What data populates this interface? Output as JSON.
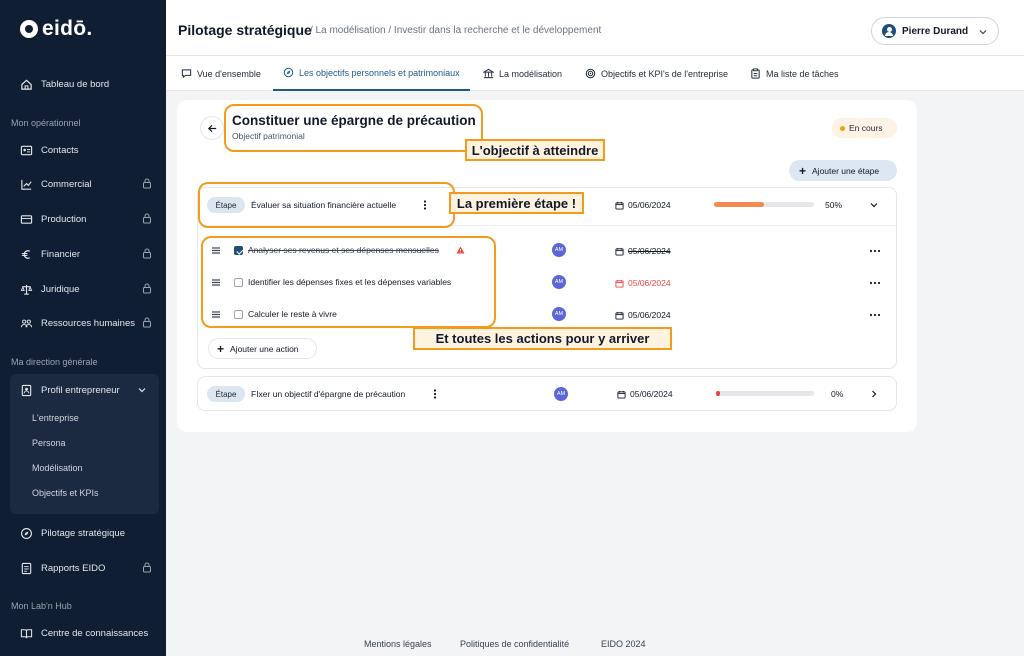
{
  "app": {
    "logo_text": "eidō."
  },
  "sidebar": {
    "top_item": {
      "label": "Tableau de bord"
    },
    "sections": [
      {
        "label": "Mon opérationnel"
      },
      {
        "label": "Ma direction générale"
      },
      {
        "label": "Mon Lab'n Hub"
      }
    ],
    "operational_items": [
      {
        "label": "Contacts",
        "icon": "contact-card-icon",
        "locked": false
      },
      {
        "label": "Commercial",
        "icon": "chart-line-icon",
        "locked": true
      },
      {
        "label": "Production",
        "icon": "production-icon",
        "locked": true
      },
      {
        "label": "Financier",
        "icon": "euro-icon",
        "locked": true
      },
      {
        "label": "Juridique",
        "icon": "scales-icon",
        "locked": true
      },
      {
        "label": "Ressources humaines",
        "icon": "people-icon",
        "locked": true
      }
    ],
    "direction_group": {
      "label": "Profil entrepreneur",
      "subitems": [
        "L'entreprise",
        "Persona",
        "Modélisation",
        "Objectifs et KPIs"
      ]
    },
    "direction_items": [
      {
        "label": "Pilotage stratégique",
        "locked": false
      },
      {
        "label": "Rapports EIDO",
        "locked": true
      }
    ],
    "hub_items": [
      {
        "label": "Centre de connaissances"
      }
    ]
  },
  "header": {
    "title": "Pilotage stratégique",
    "breadcrumb_rest": "/ La modélisation / Investir dans la recherche et le développement",
    "user_name": "Pierre Durand"
  },
  "tabs": [
    {
      "label": "Vue d'ensemble",
      "active": false
    },
    {
      "label": "Les objectifs personnels et patrimoniaux",
      "active": true
    },
    {
      "label": "La modélisation",
      "active": false
    },
    {
      "label": "Objectifs et KPI's de l'entreprise",
      "active": false
    },
    {
      "label": "Ma liste de tâches",
      "active": false
    }
  ],
  "goal": {
    "title": "Constituer une épargne de précaution",
    "subtitle": "Objectif patrimonial",
    "status": "En cours",
    "add_step_label": "Ajouter une étape"
  },
  "steps": [
    {
      "tag": "Étape",
      "name": "Évaluer sa situation financière actuelle",
      "date": "05/06/2024",
      "progress": 0.5,
      "percent_label": "50%",
      "expanded": true,
      "actions": [
        {
          "text": "Analyser ses revenus et ses dépenses mensuelles",
          "done": true,
          "warning": true,
          "assignee": "AM",
          "date": "05/06/2024",
          "date_state": "struck"
        },
        {
          "text": "Identifier les dépenses fixes et les dépenses variables",
          "done": false,
          "warning": false,
          "assignee": "AM",
          "date": "05/06/2024",
          "date_state": "overdue"
        },
        {
          "text": "Calculer le reste à vivre",
          "done": false,
          "warning": false,
          "assignee": "AM",
          "date": "05/06/2024",
          "date_state": "normal"
        }
      ],
      "add_action_label": "Ajouter une action"
    },
    {
      "tag": "Étape",
      "name": "FIxer un objectif d'épargne de précaution",
      "assignee": "AM",
      "date": "05/06/2024",
      "progress": 0.0,
      "percent_label": "0%",
      "expanded": false
    }
  ],
  "annotations": {
    "goal": "L'objectif à atteindre",
    "first_step": "La première étape !",
    "actions": "Et toutes les actions pour y arriver"
  },
  "footer": {
    "links": [
      "Mentions légales",
      "Politiques de confidentialité",
      "EIDO 2024"
    ]
  },
  "colors": {
    "sidebar_bg": "#0f1e33",
    "accent": "#1e5a8a",
    "annotation": "#f29b1e",
    "progress": "#f28b50",
    "overdue": "#ef4444"
  }
}
